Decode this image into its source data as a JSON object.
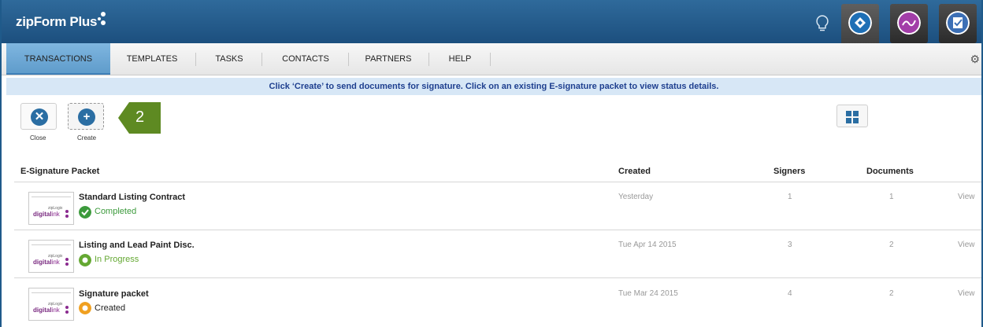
{
  "app": {
    "logo": "zipForm Plus",
    "colors": {
      "header": "#1c4f7e",
      "accent": "#5f9ccb",
      "callout": "#5e8a22",
      "completed": "#3c9a3c",
      "in_progress": "#64a832",
      "created": "#f0a020"
    }
  },
  "header": {
    "icons": [
      "lightbulb-icon",
      "digitalink-app-icon",
      "signature-app-icon",
      "forms-app-icon"
    ]
  },
  "nav": {
    "items": [
      {
        "label": "TRANSACTIONS",
        "active": true
      },
      {
        "label": "TEMPLATES"
      },
      {
        "label": "TASKS"
      },
      {
        "label": "CONTACTS"
      },
      {
        "label": "PARTNERS"
      },
      {
        "label": "HELP"
      }
    ]
  },
  "banner": {
    "text": "Click ‘Create’ to send documents for signature. Click on an existing E-signature packet to view status details."
  },
  "toolbar": {
    "close_label": "Close",
    "create_label": "Create",
    "callout_number": "2"
  },
  "table": {
    "headers": {
      "packet": "E-Signature Packet",
      "created": "Created",
      "signers": "Signers",
      "documents": "Documents"
    },
    "thumb": {
      "small": "zipLogix",
      "brand": "digital",
      "brand_suffix": "ink"
    },
    "rows": [
      {
        "title": "Standard Listing Contract",
        "status": "Completed",
        "status_color": "#3c9a3c",
        "created": "Yesterday",
        "signers": "1",
        "documents": "1",
        "action": "View"
      },
      {
        "title": "Listing and Lead Paint Disc.",
        "status": "In Progress",
        "status_color": "#64a832",
        "created": "Tue Apr 14 2015",
        "signers": "3",
        "documents": "2",
        "action": "View"
      },
      {
        "title": "Signature packet",
        "status": "Created",
        "status_color": "#f0a020",
        "created": "Tue Mar 24 2015",
        "signers": "4",
        "documents": "2",
        "action": "View"
      }
    ]
  }
}
